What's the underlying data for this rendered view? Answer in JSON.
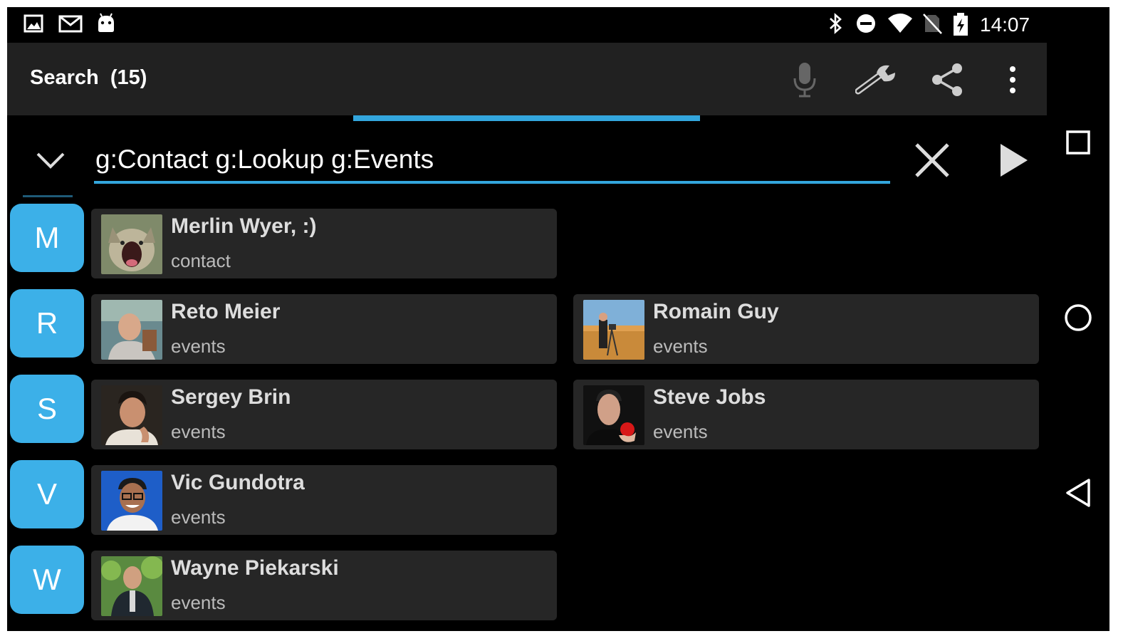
{
  "status_bar": {
    "time": "14:07",
    "left_icons": [
      "image-icon",
      "gmail-icon",
      "android-icon"
    ],
    "right_icons": [
      "bluetooth-icon",
      "do-not-disturb-icon",
      "wifi-icon",
      "no-sim-icon",
      "battery-charging-icon"
    ]
  },
  "toolbar": {
    "title": "Search  (15)",
    "actions": [
      "mic-icon",
      "wrench-icon",
      "share-icon",
      "overflow-menu-icon"
    ]
  },
  "progress": {
    "fraction": 0.333
  },
  "search": {
    "query": "g:Contact g:Lookup g:Events"
  },
  "groups": [
    {
      "letter": "M"
    },
    {
      "letter": "R"
    },
    {
      "letter": "S"
    },
    {
      "letter": "V"
    },
    {
      "letter": "W"
    }
  ],
  "results": [
    {
      "name": "Merlin Wyer, :)",
      "type": "contact"
    },
    {
      "name": "Reto Meier",
      "type": "events"
    },
    {
      "name": "Romain Guy",
      "type": "events"
    },
    {
      "name": "Sergey Brin",
      "type": "events"
    },
    {
      "name": "Steve Jobs",
      "type": "events"
    },
    {
      "name": "Vic Gundotra",
      "type": "events"
    },
    {
      "name": "Wayne Piekarski",
      "type": "events"
    }
  ],
  "nav": [
    "recents-icon",
    "home-icon",
    "back-icon"
  ],
  "colors": {
    "accent": "#33a6dd",
    "badge": "#3cb0e8",
    "toolbar": "#212121",
    "card": "#262626"
  }
}
